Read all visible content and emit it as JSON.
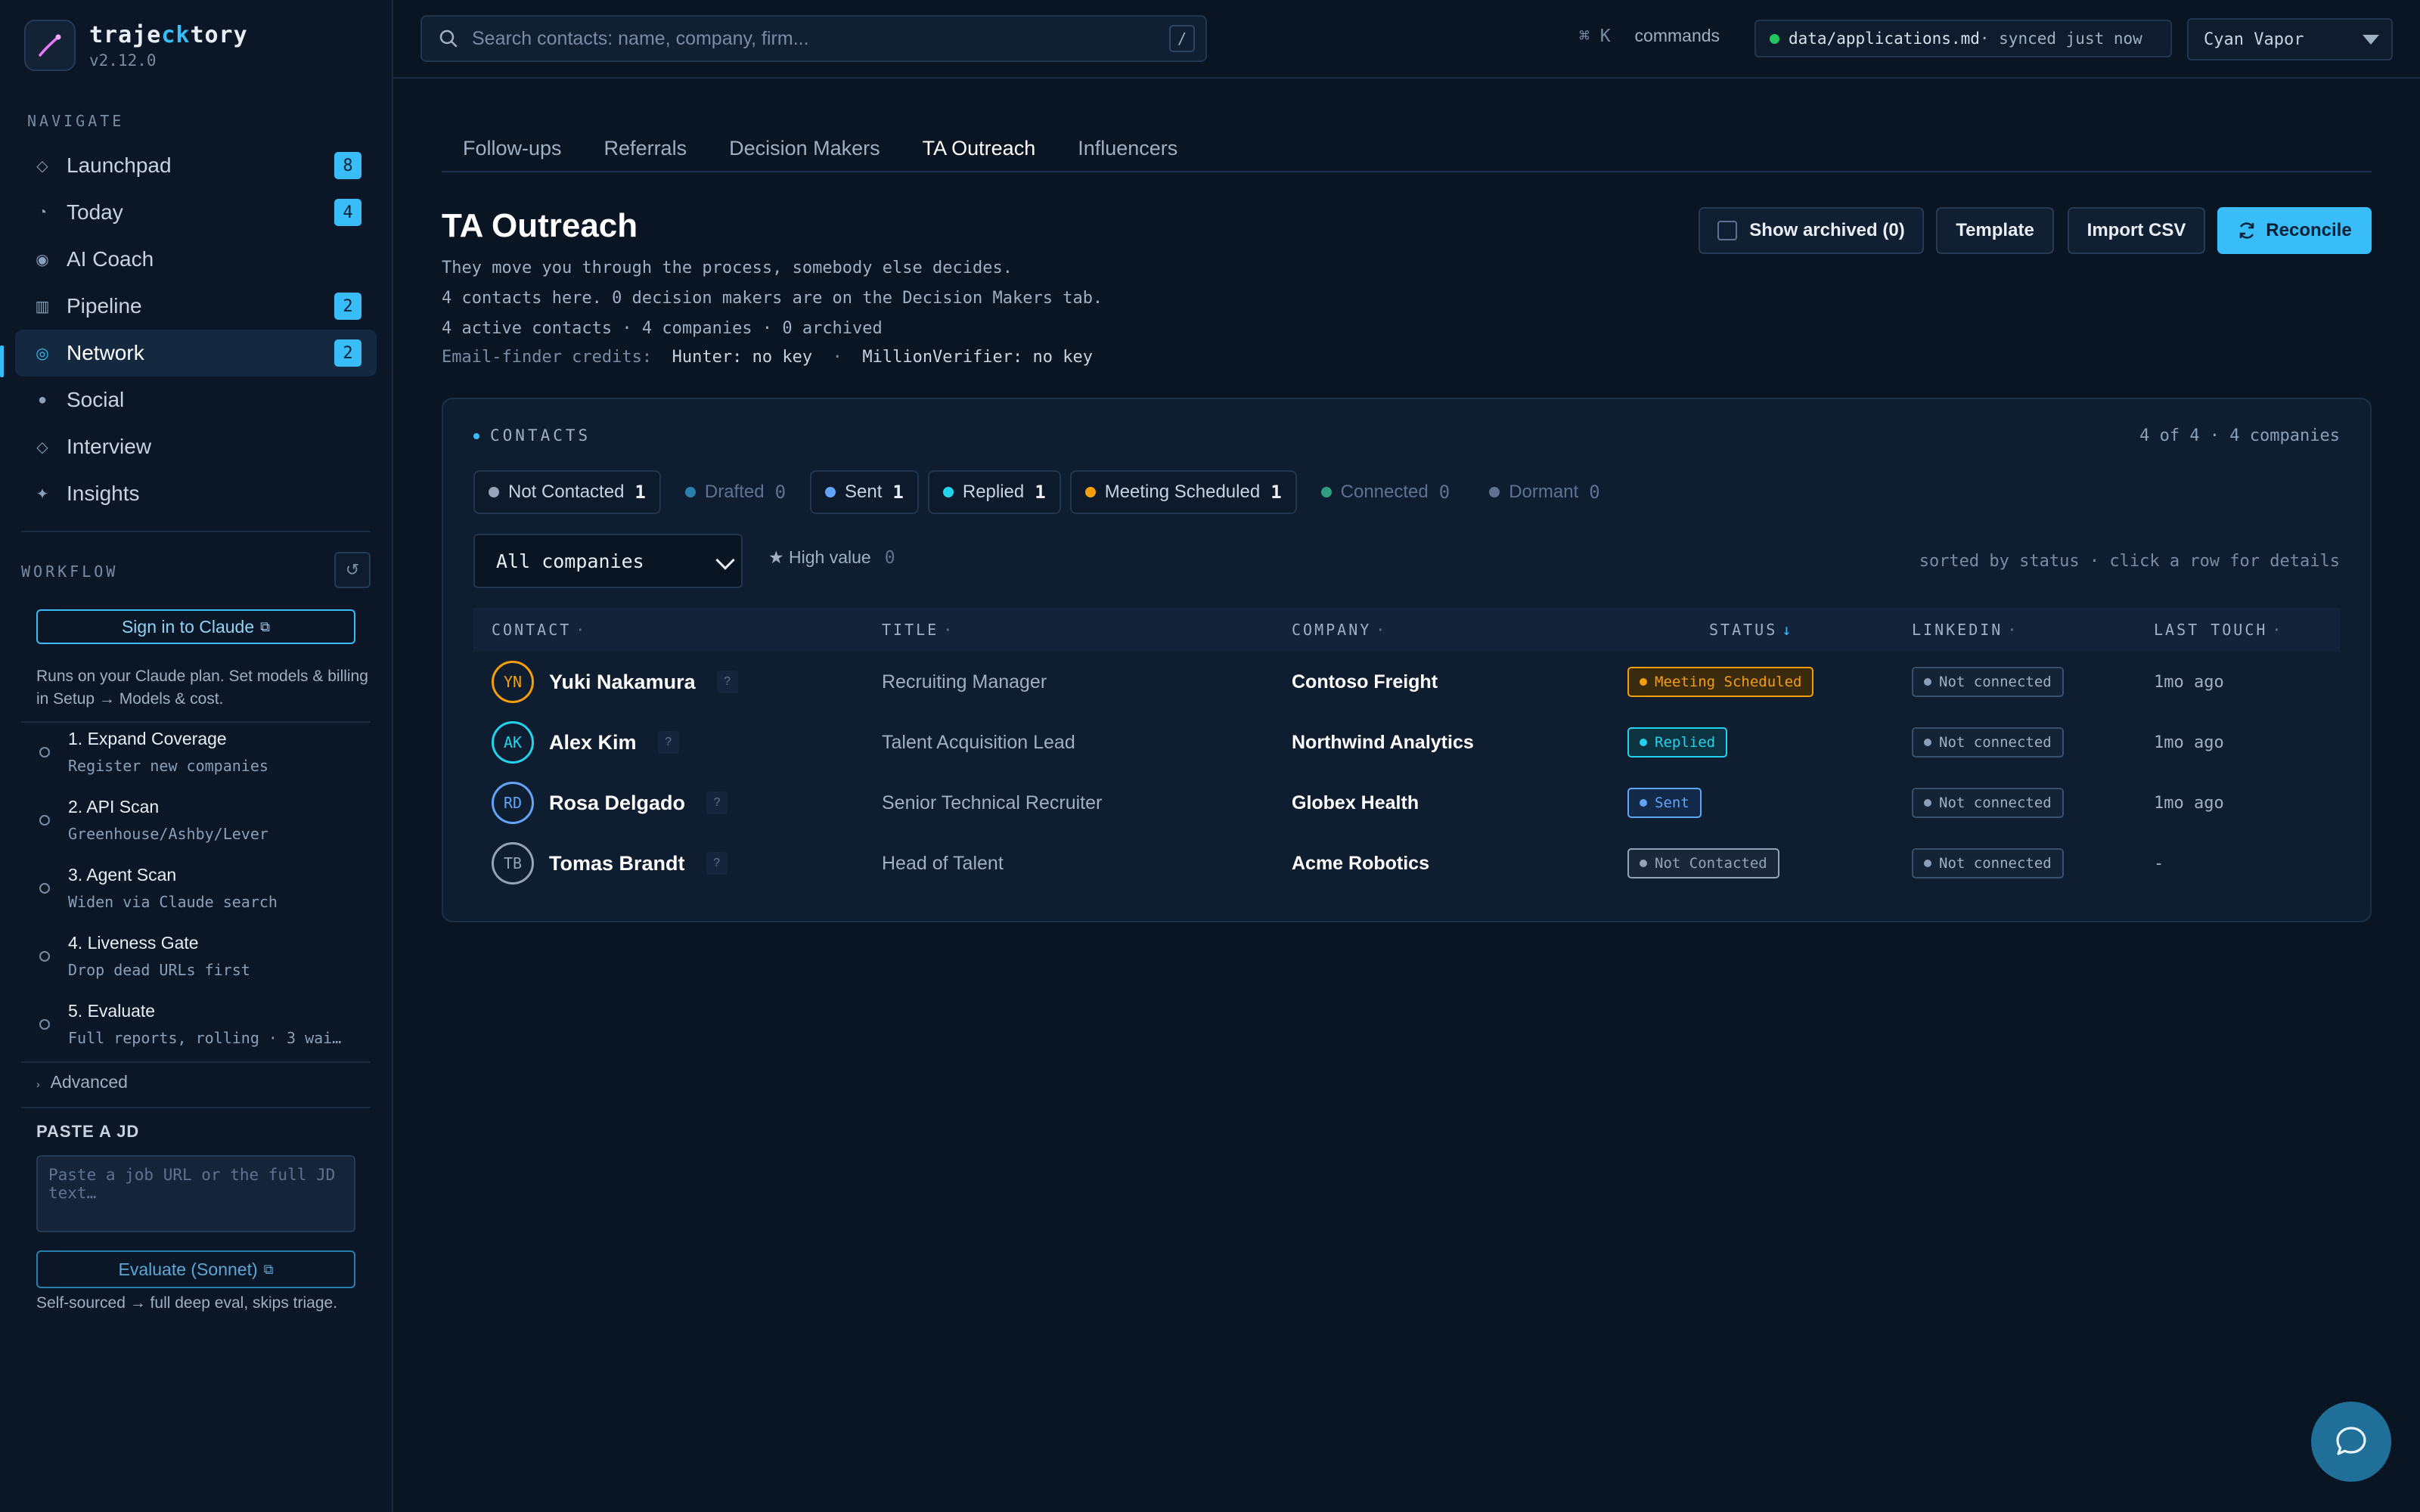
{
  "brand": {
    "name_start": "traje",
    "name_accent": "ck",
    "name_end": "tory",
    "version": "v2.12.0"
  },
  "navigate": {
    "label": "NAVIGATE",
    "items": [
      {
        "icon": "diamond-icon",
        "label": "Launchpad",
        "badge": "8"
      },
      {
        "icon": "clock-icon",
        "label": "Today",
        "badge": "4"
      },
      {
        "icon": "target-icon",
        "label": "AI Coach",
        "badge": ""
      },
      {
        "icon": "grid-icon",
        "label": "Pipeline",
        "badge": "2"
      },
      {
        "icon": "network-icon",
        "label": "Network",
        "badge": "2"
      },
      {
        "icon": "circle-icon",
        "label": "Social",
        "badge": ""
      },
      {
        "icon": "diamond-icon",
        "label": "Interview",
        "badge": ""
      },
      {
        "icon": "sparkle-icon",
        "label": "Insights",
        "badge": ""
      }
    ]
  },
  "workflow": {
    "label": "WORKFLOW",
    "sign_in": "Sign in to Claude",
    "note": "Runs on your Claude plan. Set models & billing in Setup → Models & cost.",
    "steps": [
      {
        "title": "1. Expand Coverage",
        "sub": "Register new companies"
      },
      {
        "title": "2. API Scan",
        "sub": "Greenhouse/Ashby/Lever"
      },
      {
        "title": "3. Agent Scan",
        "sub": "Widen via Claude search"
      },
      {
        "title": "4. Liveness Gate",
        "sub": "Drop dead URLs first"
      },
      {
        "title": "5. Evaluate",
        "sub": "Full reports, rolling · 3 wai…"
      }
    ],
    "advanced": "Advanced",
    "paste_label": "PASTE A JD",
    "paste_placeholder": "Paste a job URL or the full JD text…",
    "evaluate": "Evaluate (Sonnet)",
    "eval_note": "Self-sourced → full deep eval, skips triage."
  },
  "topbar": {
    "search_placeholder": "Search contacts: name, company, firm...",
    "slash": "/",
    "cmd_key": "⌘ K",
    "cmd_label": "commands",
    "sync_file": "data/applications.md",
    "sync_status": " · synced just now",
    "theme": "Cyan Vapor"
  },
  "tabs": [
    "Follow-ups",
    "Referrals",
    "Decision Makers",
    "TA Outreach",
    "Influencers"
  ],
  "page": {
    "title": "TA Outreach",
    "line1": "They move you through the process, somebody else decides.",
    "line2": "4 contacts here. 0 decision makers are on the Decision Makers tab.",
    "line3": "4 active contacts · 4 companies · 0 archived",
    "credits_label": "Email-finder credits:",
    "credits_hunter": "Hunter: no key",
    "credits_sep": "·",
    "credits_mv": "MillionVerifier: no key"
  },
  "actions": {
    "archived": "Show archived (0)",
    "template": "Template",
    "import": "Import CSV",
    "reconcile": "Reconcile"
  },
  "panel": {
    "label": "CONTACTS",
    "count": "4 of 4 · 4 companies",
    "chips": [
      {
        "label": "Not Contacted",
        "count": "1",
        "color": "#94a3b8",
        "dim": false
      },
      {
        "label": "Drafted",
        "count": "0",
        "color": "#2b7fae",
        "dim": true
      },
      {
        "label": "Sent",
        "count": "1",
        "color": "#60a5fa",
        "dim": false
      },
      {
        "label": "Replied",
        "count": "1",
        "color": "#22d3ee",
        "dim": false
      },
      {
        "label": "Meeting Scheduled",
        "count": "1",
        "color": "#f59e0b",
        "dim": false
      },
      {
        "label": "Connected",
        "count": "0",
        "color": "#2f9e80",
        "dim": true
      },
      {
        "label": "Dormant",
        "count": "0",
        "color": "#5f7390",
        "dim": true
      }
    ],
    "company_filter": "All companies",
    "high_value": "★ High value",
    "high_value_count": "0",
    "sort_note": "sorted by status · click a row for details",
    "headers": {
      "contact": "CONTACT",
      "title": "TITLE",
      "company": "COMPANY",
      "status": "STATUS",
      "linkedin": "LINKEDIN",
      "last_touch": "LAST TOUCH"
    }
  },
  "contacts": [
    {
      "initials": "YN",
      "name": "Yuki Nakamura",
      "title": "Recruiting Manager",
      "company": "Contoso Freight",
      "status": "Meeting Scheduled",
      "status_color": "#f59e0b",
      "status_bg": "#3a2a0e",
      "avatar_color": "#f59e0b",
      "linkedin": "Not connected",
      "last_touch": "1mo ago"
    },
    {
      "initials": "AK",
      "name": "Alex Kim",
      "title": "Talent Acquisition Lead",
      "company": "Northwind Analytics",
      "status": "Replied",
      "status_color": "#22d3ee",
      "status_bg": "#0c3340",
      "avatar_color": "#22d3ee",
      "linkedin": "Not connected",
      "last_touch": "1mo ago"
    },
    {
      "initials": "RD",
      "name": "Rosa Delgado",
      "title": "Senior Technical Recruiter",
      "company": "Globex Health",
      "status": "Sent",
      "status_color": "#60a5fa",
      "status_bg": "#13294a",
      "avatar_color": "#60a5fa",
      "linkedin": "Not connected",
      "last_touch": "1mo ago"
    },
    {
      "initials": "TB",
      "name": "Tomas Brandt",
      "title": "Head of Talent",
      "company": "Acme Robotics",
      "status": "Not Contacted",
      "status_color": "#94a3b8",
      "status_bg": "#1a2738",
      "avatar_color": "#94a3b8",
      "linkedin": "Not connected",
      "last_touch": "-"
    }
  ]
}
